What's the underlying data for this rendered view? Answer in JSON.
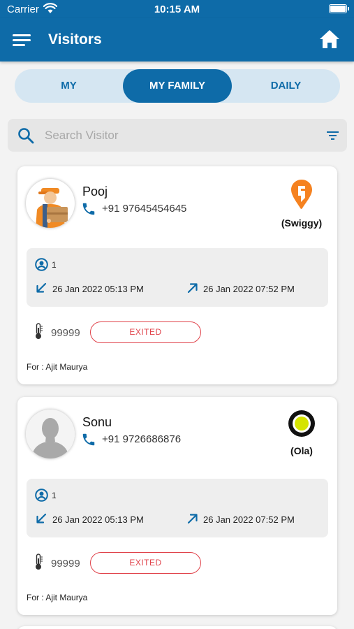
{
  "status_bar": {
    "carrier": "Carrier",
    "time": "10:15 AM"
  },
  "header": {
    "title": "Visitors"
  },
  "tabs": [
    {
      "label": "MY",
      "active": false
    },
    {
      "label": "MY FAMILY",
      "active": true
    },
    {
      "label": "DAILY",
      "active": false
    }
  ],
  "search": {
    "placeholder": "Search Visitor",
    "value": ""
  },
  "visitors": [
    {
      "name": "Pooj",
      "phone": "+91 97645454645",
      "brand": "(Swiggy)",
      "brand_color": "#f58220",
      "guest_count": "1",
      "in_time": "26 Jan 2022 05:13 PM",
      "out_time": "26 Jan 2022 07:52 PM",
      "temperature": "99999",
      "status": "EXITED",
      "for": "For : Ajit Maurya"
    },
    {
      "name": "Sonu",
      "phone": "+91 9726686876",
      "brand": "(Ola)",
      "brand_color": "#d5e400",
      "guest_count": "1",
      "in_time": "26 Jan 2022 05:13 PM",
      "out_time": "26 Jan 2022 07:52 PM",
      "temperature": "99999",
      "status": "EXITED",
      "for": "For : Ajit Maurya"
    }
  ],
  "theme": {
    "primary": "#0e6ba8",
    "danger": "#e0424a"
  }
}
